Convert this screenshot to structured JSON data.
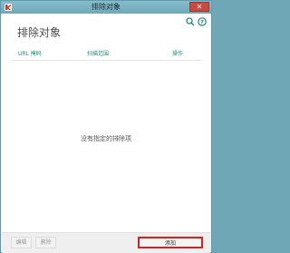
{
  "window": {
    "title": "排除对象",
    "close_glyph": "✕"
  },
  "header": {
    "heading": "排除对象",
    "search_icon": "search-icon",
    "help_icon": "help-icon"
  },
  "table": {
    "columns": [
      "URL 掩码",
      "扫描范围",
      "操作"
    ],
    "empty_message": "没有指定的排除项"
  },
  "footer": {
    "edit_label": "编辑",
    "delete_label": "删除",
    "add_label": "添加"
  },
  "colors": {
    "accent": "#1f8a7b",
    "titlebar": "#6ea9ba",
    "highlight": "#d42020"
  }
}
